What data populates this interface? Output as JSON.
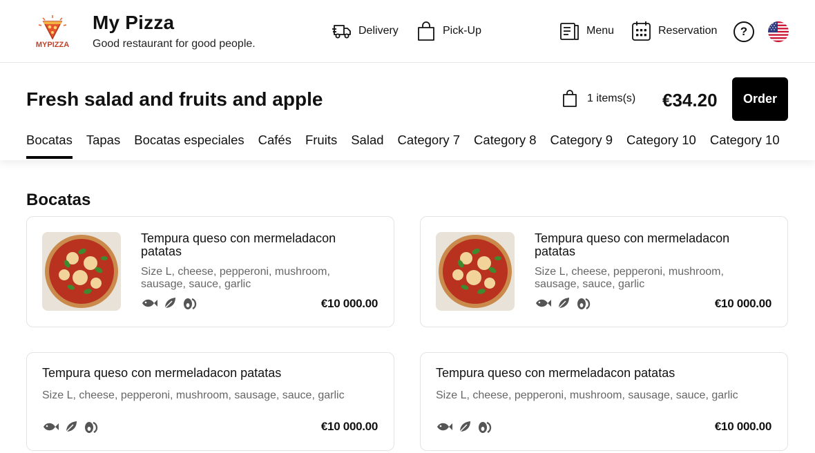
{
  "brand": {
    "logo_text": "MYPIZZA",
    "name": "My Pizza",
    "tagline": "Good restaurant for good people."
  },
  "nav": {
    "delivery": "Delivery",
    "pickup": "Pick-Up",
    "menu": "Menu",
    "reservation": "Reservation",
    "help": "?"
  },
  "order_bar": {
    "title": "Fresh salad and fruits and apple",
    "cart_count": "1 items(s)",
    "total": "€34.20",
    "order_button": "Order"
  },
  "tabs": [
    "Bocatas",
    "Tapas",
    "Bocatas especiales",
    "Cafés",
    "Fruits",
    "Salad",
    "Category 7",
    "Category 8",
    "Category 9",
    "Category 10",
    "Category 10"
  ],
  "section_title": "Bocatas",
  "products": [
    {
      "title": "Tempura queso con mermeladacon patatas",
      "description": "Size L, cheese, pepperoni, mushroom, sausage, sauce, garlic",
      "price": "€10 000.00",
      "has_image": true
    },
    {
      "title": "Tempura queso con mermeladacon patatas",
      "description": "Size L, cheese, pepperoni, mushroom, sausage, sauce, garlic",
      "price": "€10 000.00",
      "has_image": true
    },
    {
      "title": "Tempura queso con mermeladacon patatas",
      "description": "Size L, cheese, pepperoni, mushroom, sausage, sauce, garlic",
      "price": "€10 000.00",
      "has_image": false
    },
    {
      "title": "Tempura queso con mermeladacon patatas",
      "description": "Size L, cheese, pepperoni, mushroom, sausage, sauce, garlic",
      "price": "€10 000.00",
      "has_image": false
    }
  ],
  "allergen_icons": [
    "fish-icon",
    "leaf-icon",
    "egg-icon"
  ],
  "colors": {
    "accent": "#000000",
    "muted_text": "#666666",
    "icon_gray": "#555555",
    "border": "#e3e3e3"
  }
}
